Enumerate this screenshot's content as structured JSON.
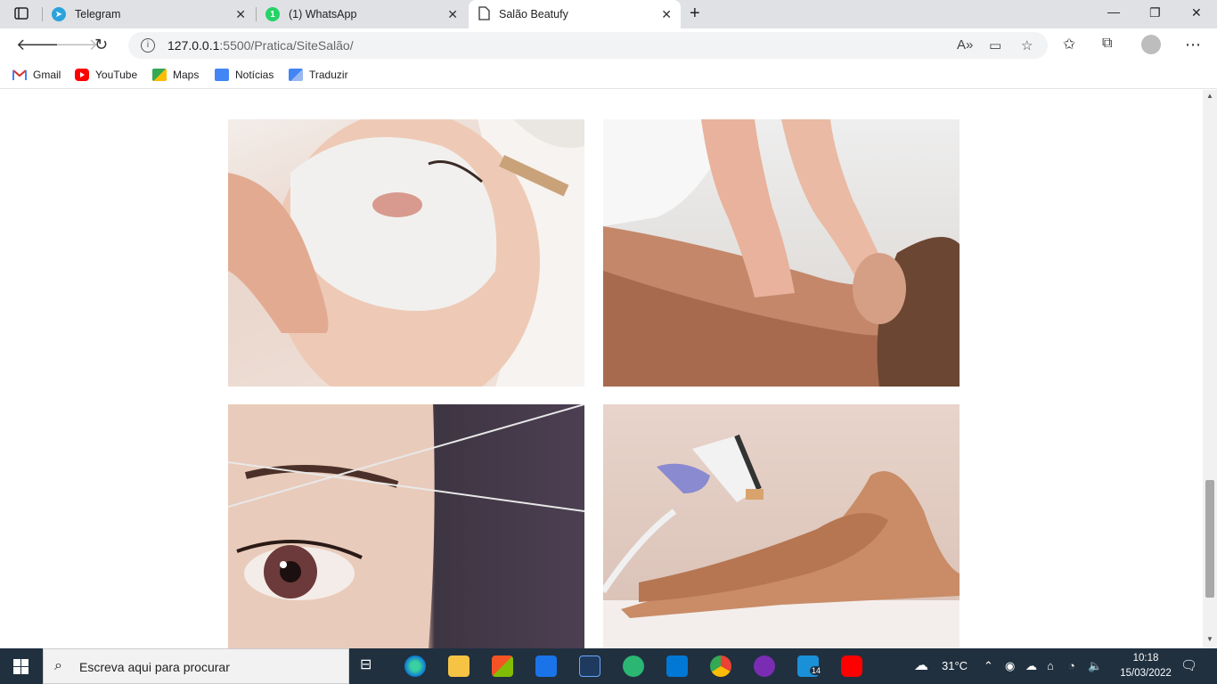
{
  "browser": {
    "tabs": [
      {
        "label": "Telegram",
        "icon": "telegram-icon",
        "color": "#2aa3dd"
      },
      {
        "label": "(1) WhatsApp",
        "icon": "whatsapp-icon",
        "color": "#25d366",
        "badge": "1"
      },
      {
        "label": "Salão Beatufy",
        "icon": "page-icon",
        "active": true
      }
    ],
    "url_host": "127.0.0.1",
    "url_path": ":5500/Pratica/SiteSalão/",
    "bookmarks": [
      {
        "label": "Gmail",
        "icon": "gmail-icon",
        "color": "#d93025"
      },
      {
        "label": "YouTube",
        "icon": "youtube-icon",
        "color": "#ff0000"
      },
      {
        "label": "Maps",
        "icon": "maps-icon",
        "color": "#34a853"
      },
      {
        "label": "Notícias",
        "icon": "news-icon",
        "color": "#4285f4"
      },
      {
        "label": "Traduzir",
        "icon": "translate-icon",
        "color": "#4285f4"
      }
    ]
  },
  "page": {
    "gallery": [
      {
        "name": "facial-mask-photo",
        "alt": "facial mask treatment"
      },
      {
        "name": "back-massage-photo",
        "alt": "back massage"
      },
      {
        "name": "eyebrow-threading-photo",
        "alt": "eyebrow threading"
      },
      {
        "name": "laser-hair-removal-photo",
        "alt": "laser hair removal"
      }
    ]
  },
  "taskbar": {
    "search_placeholder": "Escreva aqui para procurar",
    "weather": "31°C",
    "time": "10:18",
    "date": "15/03/2022",
    "badge_count": "14"
  }
}
